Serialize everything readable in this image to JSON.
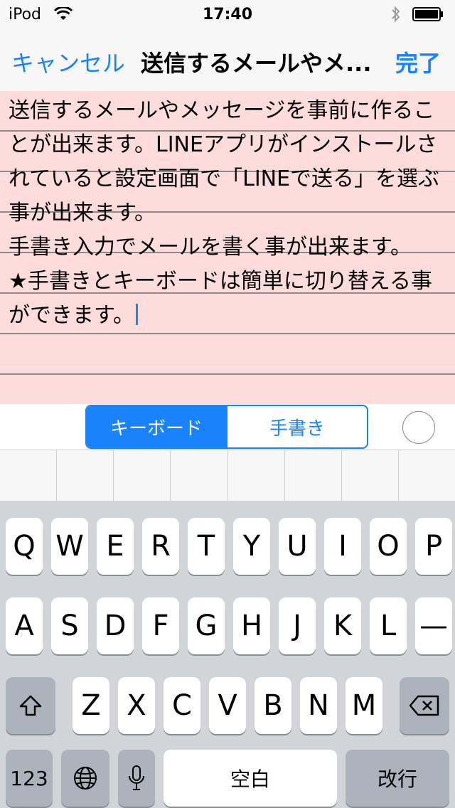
{
  "status_bar": {
    "carrier": "iPod",
    "time": "17:40"
  },
  "nav": {
    "cancel_label": "キャンセル",
    "title": "送信するメールやメ...",
    "done_label": "完了"
  },
  "editor": {
    "text": "送信するメールやメッセージを事前に作ることが出来ます。LINEアプリがインストールされていると設定画面で「LINEで送る」を選ぶ事が出来ます。\n手書き入力でメールを書く事が出来ます。\n★手書きとキーボードは簡単に切り替える事ができます。"
  },
  "segment": {
    "keyboard_label": "キーボード",
    "handwriting_label": "手書き",
    "selected": "keyboard"
  },
  "keyboard": {
    "row1": [
      "Q",
      "W",
      "E",
      "R",
      "T",
      "Y",
      "U",
      "I",
      "O",
      "P"
    ],
    "row2": [
      "A",
      "S",
      "D",
      "F",
      "G",
      "H",
      "J",
      "K",
      "L",
      "—"
    ],
    "row3": [
      "Z",
      "X",
      "C",
      "V",
      "B",
      "N",
      "M"
    ],
    "numbers_label": "123",
    "space_label": "空白",
    "return_label": "改行"
  },
  "icons": {
    "shift": "shift-icon",
    "delete": "delete-icon",
    "globe": "globe-icon",
    "mic": "microphone-icon",
    "wifi": "wifi-icon",
    "bluetooth": "bluetooth-icon",
    "battery": "battery-icon"
  },
  "colors": {
    "accent": "#1a82fb",
    "editor_bg": "#ffdcdc",
    "keyboard_bg": "#d1d4d9"
  }
}
